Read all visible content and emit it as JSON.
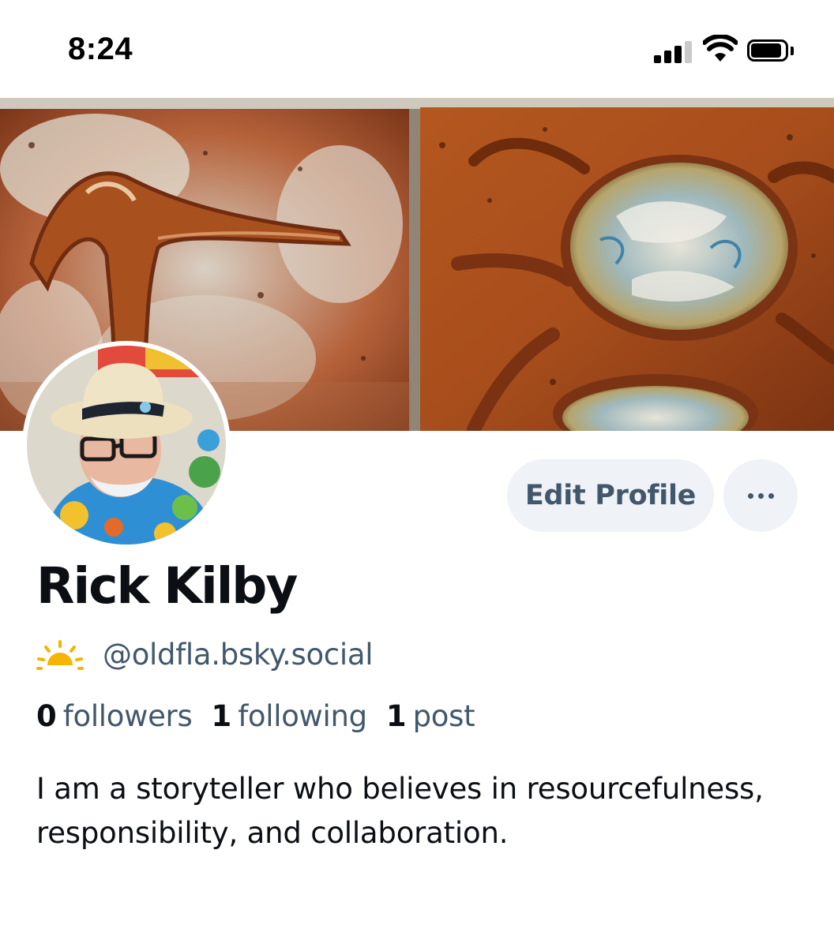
{
  "status_bar": {
    "time": "8:24",
    "icons": [
      "cellular-signal-icon",
      "wifi-icon",
      "battery-icon"
    ]
  },
  "profile": {
    "banner_image": "glazed ceramic tiles with bird and turtle relief",
    "avatar_image": "man in straw hat, glasses and tropical shirt",
    "display_name": "Rick Kilby",
    "handle_icon": "sun-emoji-icon",
    "handle": "@oldfla.bsky.social",
    "stats": [
      {
        "count": "0",
        "label": "followers"
      },
      {
        "count": "1",
        "label": "following"
      },
      {
        "count": "1",
        "label": "post"
      }
    ],
    "bio": "I am a storyteller who believes in resourcefulness, responsibility, and collaboration."
  },
  "actions": {
    "edit_profile_label": "Edit Profile",
    "more_icon": "ellipsis-icon"
  },
  "colors": {
    "text_primary": "#0b0f14",
    "text_secondary": "#42576c",
    "button_bg": "#eff2f6",
    "sun": "#f5b400"
  }
}
